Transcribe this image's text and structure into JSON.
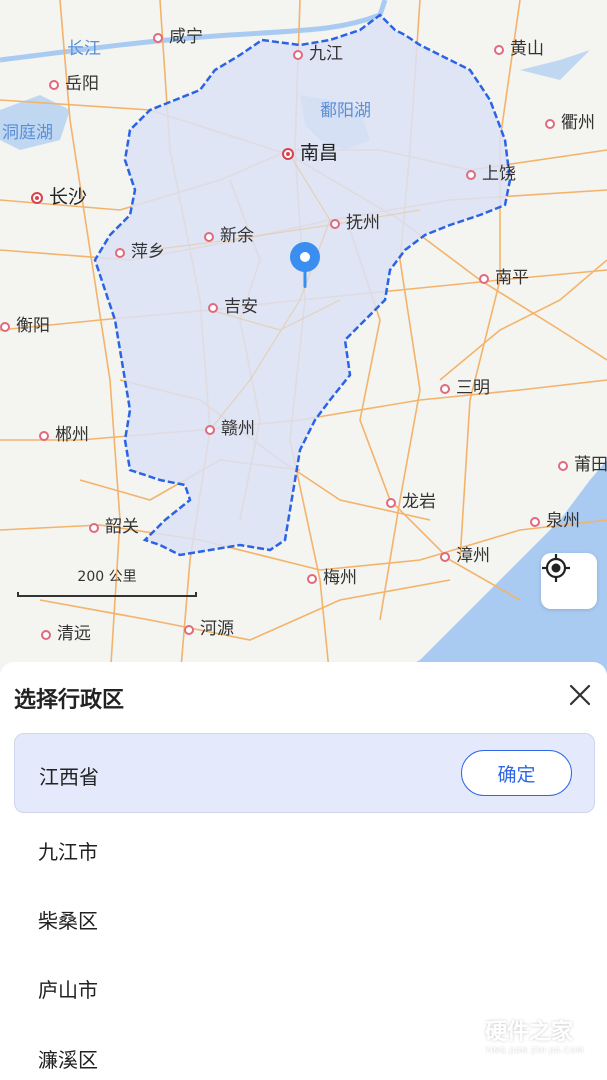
{
  "map": {
    "cities": [
      {
        "id": "xianning",
        "name": "咸宁",
        "capital": false
      },
      {
        "id": "jiujiang",
        "name": "九江",
        "capital": false
      },
      {
        "id": "huangshan",
        "name": "黄山",
        "capital": false
      },
      {
        "id": "yueyang",
        "name": "岳阳",
        "capital": false
      },
      {
        "id": "quzhou",
        "name": "衢州",
        "capital": false
      },
      {
        "id": "nanchang",
        "name": "南昌",
        "capital": true
      },
      {
        "id": "shangrao",
        "name": "上饶",
        "capital": false
      },
      {
        "id": "changsha",
        "name": "长沙",
        "capital": true
      },
      {
        "id": "fuzhou-jx",
        "name": "抚州",
        "capital": false
      },
      {
        "id": "pingxiang",
        "name": "萍乡",
        "capital": false
      },
      {
        "id": "xinyu",
        "name": "新余",
        "capital": false
      },
      {
        "id": "nanping",
        "name": "南平",
        "capital": false
      },
      {
        "id": "jian",
        "name": "吉安",
        "capital": false
      },
      {
        "id": "hengyang",
        "name": "衡阳",
        "capital": false
      },
      {
        "id": "sanming",
        "name": "三明",
        "capital": false
      },
      {
        "id": "chenzhou",
        "name": "郴州",
        "capital": false
      },
      {
        "id": "ganzhou",
        "name": "赣州",
        "capital": false
      },
      {
        "id": "putian",
        "name": "莆田",
        "capital": false
      },
      {
        "id": "longyan",
        "name": "龙岩",
        "capital": false
      },
      {
        "id": "shaoguan",
        "name": "韶关",
        "capital": false
      },
      {
        "id": "quanzhou",
        "name": "泉州",
        "capital": false
      },
      {
        "id": "zhangzhou",
        "name": "漳州",
        "capital": false
      },
      {
        "id": "meizhou",
        "name": "梅州",
        "capital": false
      },
      {
        "id": "qingyuan",
        "name": "清远",
        "capital": false
      },
      {
        "id": "heyuan",
        "name": "河源",
        "capital": false
      }
    ],
    "water_labels": [
      {
        "id": "changjiang",
        "name": "长江"
      },
      {
        "id": "dongtinghu",
        "name": "洞庭湖"
      },
      {
        "id": "poyanghu",
        "name": "鄱阳湖"
      }
    ],
    "scale_label": "200 公里",
    "colors": {
      "province_fill": "#dbe2f6",
      "province_border": "#2b63e6",
      "road": "#f4b36a",
      "water": "#a9cbf2"
    }
  },
  "sheet": {
    "title": "选择行政区",
    "selected": {
      "label": "江西省",
      "confirm_label": "确定"
    },
    "items": [
      "九江市",
      "柴桑区",
      "庐山市",
      "濂溪区"
    ]
  },
  "watermark": {
    "main": "硬件之家",
    "sub": "YING JIAN ZHI JIA.COM"
  }
}
